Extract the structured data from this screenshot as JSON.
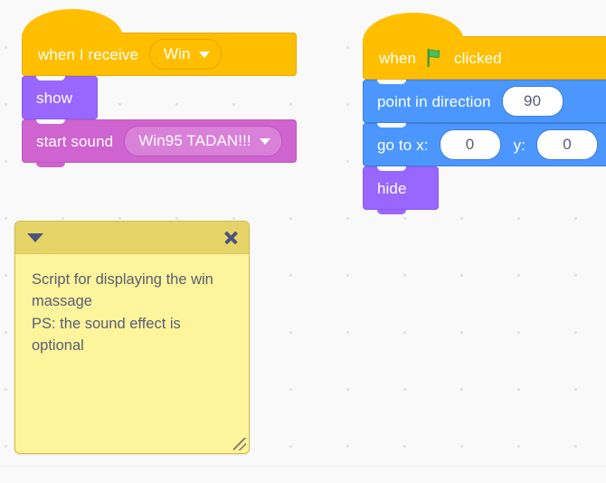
{
  "workspace": {
    "background_color": "#f9f9f9",
    "dot_color": "#e3e3e3"
  },
  "scripts": [
    {
      "name": "win-message-script",
      "blocks": [
        {
          "kind": "hat",
          "category": "events",
          "color": "#ffbf00",
          "label": "when I receive",
          "dropdown_value": "Win"
        },
        {
          "kind": "stack",
          "category": "looks",
          "color": "#9966ff",
          "label": "show"
        },
        {
          "kind": "stack",
          "category": "sound",
          "color": "#cf63cf",
          "label": "start sound",
          "dropdown_value": "Win95 TADAN!!!"
        }
      ]
    },
    {
      "name": "green-flag-script",
      "blocks": [
        {
          "kind": "hat",
          "category": "events",
          "color": "#ffbf00",
          "label_before": "when",
          "icon": "green-flag-icon",
          "label_after": "clicked"
        },
        {
          "kind": "stack",
          "category": "motion",
          "color": "#4c97ff",
          "label": "point in direction",
          "value": "90"
        },
        {
          "kind": "stack",
          "category": "motion",
          "color": "#4c97ff",
          "label_x": "go to x:",
          "value_x": "0",
          "label_y": "y:",
          "value_y": "0"
        },
        {
          "kind": "stack",
          "category": "looks",
          "color": "#9966ff",
          "label": "hide"
        }
      ]
    }
  ],
  "comment": {
    "name": "workspace-comment",
    "header_color": "#e6d469",
    "body_color": "#fef49c",
    "collapse_icon": "triangle-down-icon",
    "close_icon": "close-icon",
    "resize_icon": "resize-handle-icon",
    "text": "Script for displaying the win massage\nPS: the sound effect is optional"
  }
}
